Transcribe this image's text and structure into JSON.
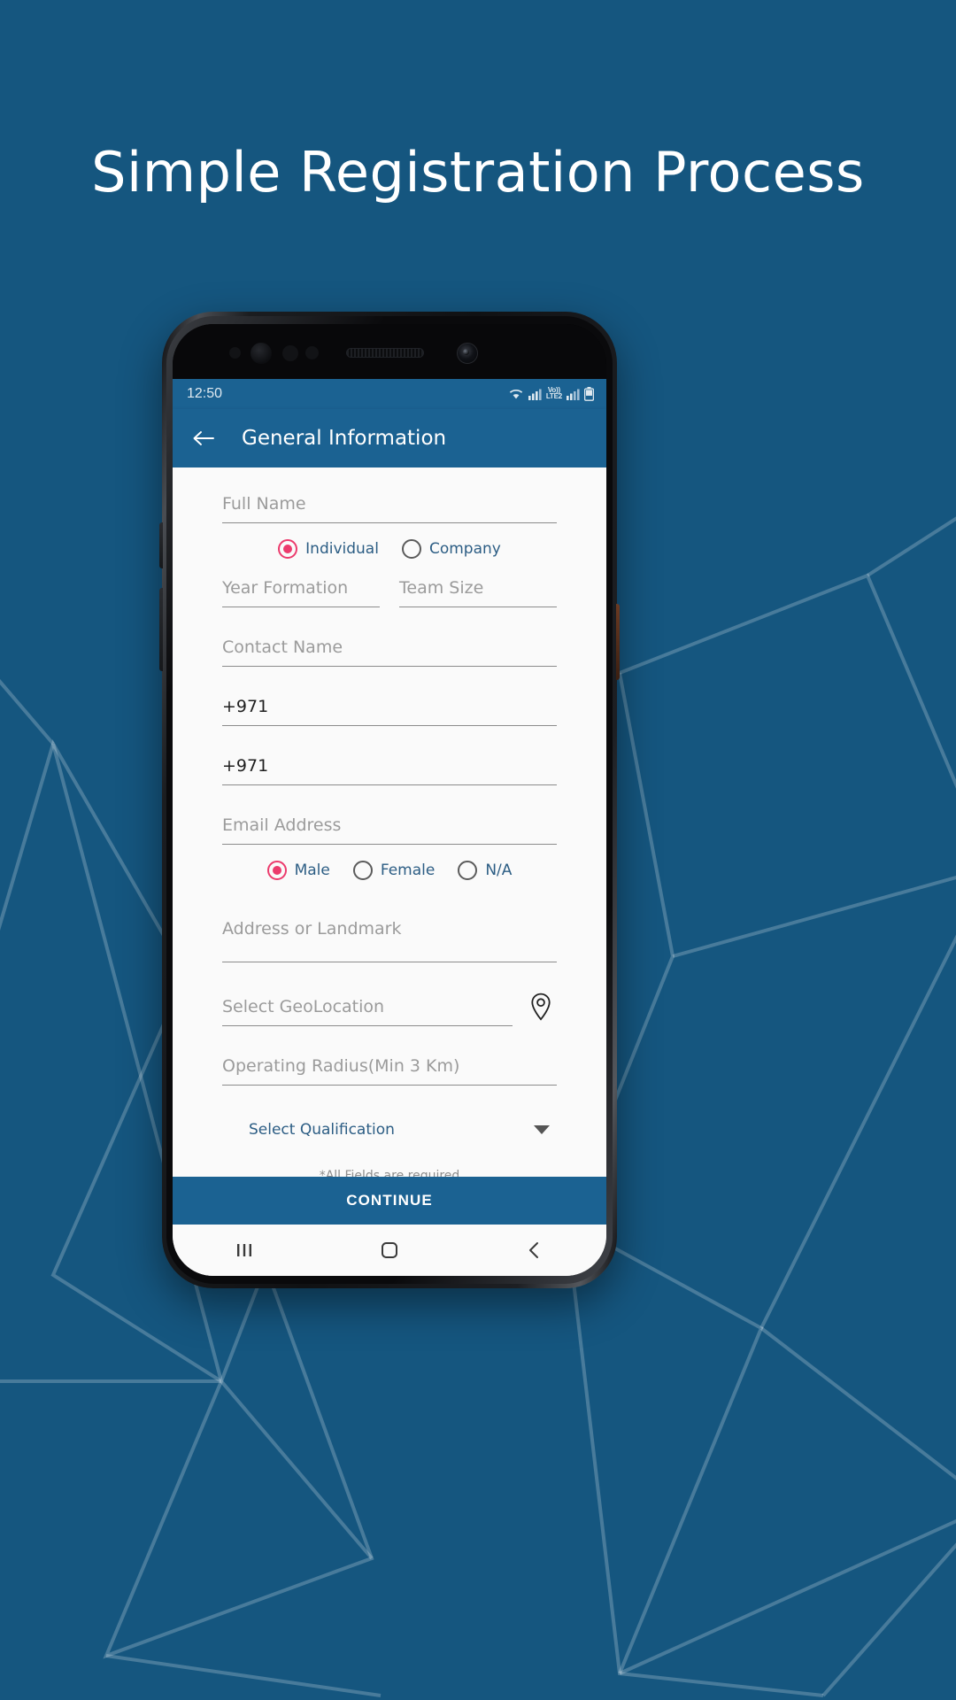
{
  "page": {
    "headline": "Simple Registration Process",
    "background_color": "#15567f",
    "accent_color": "#1b6292",
    "radio_color": "#ec3b6d"
  },
  "phone": {
    "statusbar": {
      "time": "12:50",
      "icons": [
        "wifi-icon",
        "signal-icon",
        "volte-icon",
        "signal-icon",
        "battery-icon"
      ],
      "volte_top": "Vo))",
      "volte_bottom": "LTE2"
    },
    "appbar": {
      "back_icon": "arrow-left-icon",
      "title": "General Information"
    },
    "form": {
      "full_name": {
        "placeholder": "Full Name",
        "value": ""
      },
      "entity_type": {
        "options": [
          {
            "label": "Individual",
            "selected": true
          },
          {
            "label": "Company",
            "selected": false
          }
        ]
      },
      "year_formation": {
        "placeholder": "Year Formation",
        "value": ""
      },
      "team_size": {
        "placeholder": "Team Size",
        "value": ""
      },
      "contact_name": {
        "placeholder": "Contact Name",
        "value": ""
      },
      "phone_primary": {
        "placeholder": "",
        "value": "+971"
      },
      "phone_secondary": {
        "placeholder": "",
        "value": "+971"
      },
      "email": {
        "placeholder": "Email Address",
        "value": ""
      },
      "gender": {
        "options": [
          {
            "label": "Male",
            "selected": true
          },
          {
            "label": "Female",
            "selected": false
          },
          {
            "label": "N/A",
            "selected": false
          }
        ]
      },
      "address": {
        "placeholder": "Address or Landmark",
        "value": ""
      },
      "geolocation": {
        "placeholder": "Select GeoLocation",
        "value": "",
        "icon": "map-pin-icon"
      },
      "operating_radius": {
        "placeholder": "Operating Radius(Min 3 Km)",
        "value": ""
      },
      "qualification": {
        "label": "Select Qualification",
        "icon": "chevron-down-icon"
      },
      "note": "*All Fields are required"
    },
    "continue_button": "CONTINUE",
    "navbar": {
      "recents_icon": "recents-icon",
      "home_icon": "home-icon",
      "back_icon": "back-chevron-icon"
    }
  }
}
